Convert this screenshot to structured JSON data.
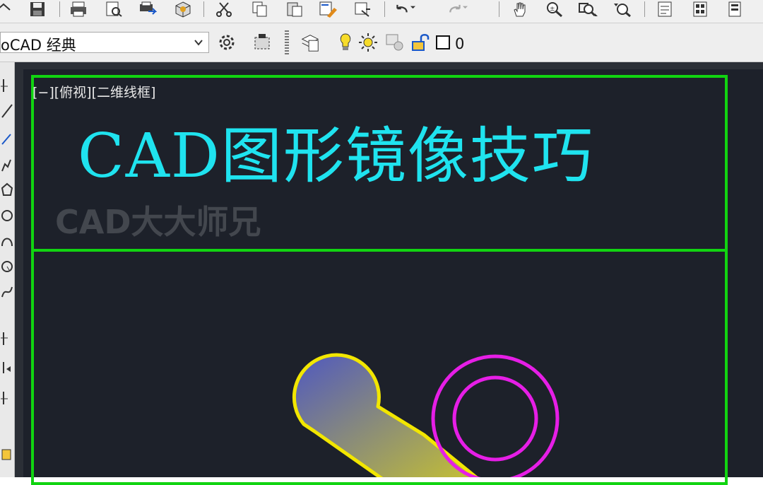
{
  "workspace": {
    "label": "oCAD 经典"
  },
  "layer": {
    "current": "0"
  },
  "viewport": {
    "label": "[−][俯视][二维线框]"
  },
  "drawing": {
    "title": "CAD图形镜像技巧",
    "watermark": "CAD大大师兄",
    "frame_color": "#11d411",
    "title_color": "#1fe3ef",
    "shape_outline_color": "#f2e600",
    "circle_color": "#e61ee6"
  },
  "icons": {
    "toolbar": [
      "pan-icon",
      "save-icon",
      "print-icon",
      "print-preview-icon",
      "publish-icon",
      "3d-icon",
      "cut-icon",
      "copy-icon",
      "paste-icon",
      "match-properties-icon",
      "block-icon",
      "undo-icon",
      "redo-icon",
      "pan-hand-icon",
      "zoom-realtime-icon",
      "zoom-window-icon",
      "zoom-previous-icon",
      "properties-icon",
      "design-center-icon",
      "tool-palette-icon"
    ]
  }
}
